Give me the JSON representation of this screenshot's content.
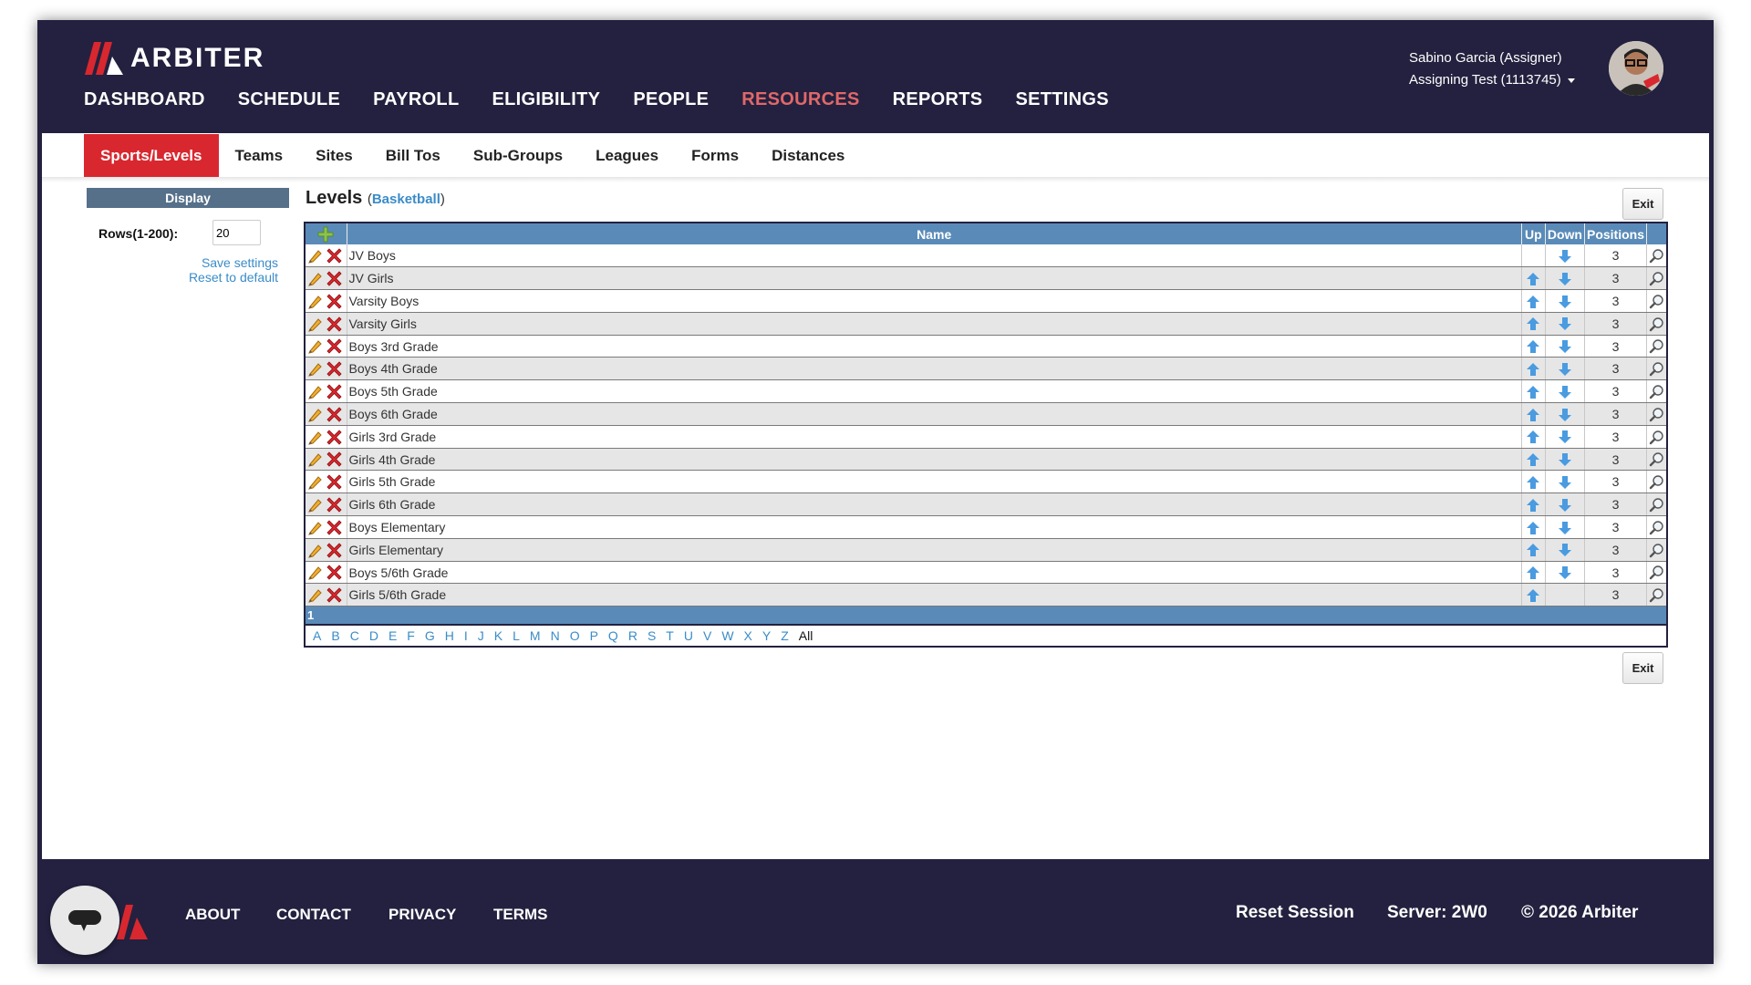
{
  "brand": {
    "name": "ARBITER",
    "accent": "#d9272f",
    "nav_bg": "#23213f"
  },
  "topnav": [
    {
      "label": "DASHBOARD",
      "active": false
    },
    {
      "label": "SCHEDULE",
      "active": false
    },
    {
      "label": "PAYROLL",
      "active": false
    },
    {
      "label": "ELIGIBILITY",
      "active": false
    },
    {
      "label": "PEOPLE",
      "active": false
    },
    {
      "label": "RESOURCES",
      "active": true
    },
    {
      "label": "REPORTS",
      "active": false
    },
    {
      "label": "SETTINGS",
      "active": false
    }
  ],
  "user": {
    "name": "Sabino Garcia (Assigner)",
    "account": "Assigning Test (1113745)"
  },
  "subnav": [
    {
      "label": "Sports/Levels",
      "active": true
    },
    {
      "label": "Teams",
      "active": false
    },
    {
      "label": "Sites",
      "active": false
    },
    {
      "label": "Bill Tos",
      "active": false
    },
    {
      "label": "Sub-Groups",
      "active": false
    },
    {
      "label": "Leagues",
      "active": false
    },
    {
      "label": "Forms",
      "active": false
    },
    {
      "label": "Distances",
      "active": false
    }
  ],
  "sidebar": {
    "header": "Display",
    "rows_label": "Rows(1-200):",
    "rows_value": "20",
    "save_label": "Save settings",
    "reset_label": "Reset to default"
  },
  "main": {
    "title": "Levels",
    "sport": "Basketball",
    "exit_label": "Exit",
    "columns": {
      "name": "Name",
      "up": "Up",
      "down": "Down",
      "positions": "Positions"
    },
    "rows": [
      {
        "name": "JV Boys",
        "positions": "3"
      },
      {
        "name": "JV Girls",
        "positions": "3"
      },
      {
        "name": "Varsity Boys",
        "positions": "3"
      },
      {
        "name": "Varsity Girls",
        "positions": "3"
      },
      {
        "name": "Boys 3rd Grade",
        "positions": "3"
      },
      {
        "name": "Boys 4th Grade",
        "positions": "3"
      },
      {
        "name": "Boys 5th Grade",
        "positions": "3"
      },
      {
        "name": "Boys 6th Grade",
        "positions": "3"
      },
      {
        "name": "Girls 3rd Grade",
        "positions": "3"
      },
      {
        "name": "Girls 4th Grade",
        "positions": "3"
      },
      {
        "name": "Girls 5th Grade",
        "positions": "3"
      },
      {
        "name": "Girls 6th Grade",
        "positions": "3"
      },
      {
        "name": "Boys Elementary",
        "positions": "3"
      },
      {
        "name": "Girls Elementary",
        "positions": "3"
      },
      {
        "name": "Boys 5/6th Grade",
        "positions": "3"
      },
      {
        "name": "Girls 5/6th Grade",
        "positions": "3"
      }
    ],
    "page": "1",
    "alphabet": [
      "A",
      "B",
      "C",
      "D",
      "E",
      "F",
      "G",
      "H",
      "I",
      "J",
      "K",
      "L",
      "M",
      "N",
      "O",
      "P",
      "Q",
      "R",
      "S",
      "T",
      "U",
      "V",
      "W",
      "X",
      "Y",
      "Z"
    ],
    "all_label": "All"
  },
  "footer": {
    "links": [
      "ABOUT",
      "CONTACT",
      "PRIVACY",
      "TERMS"
    ],
    "reset_session": "Reset Session",
    "server": "Server: 2W0",
    "copyright": "© 2026 Arbiter"
  }
}
